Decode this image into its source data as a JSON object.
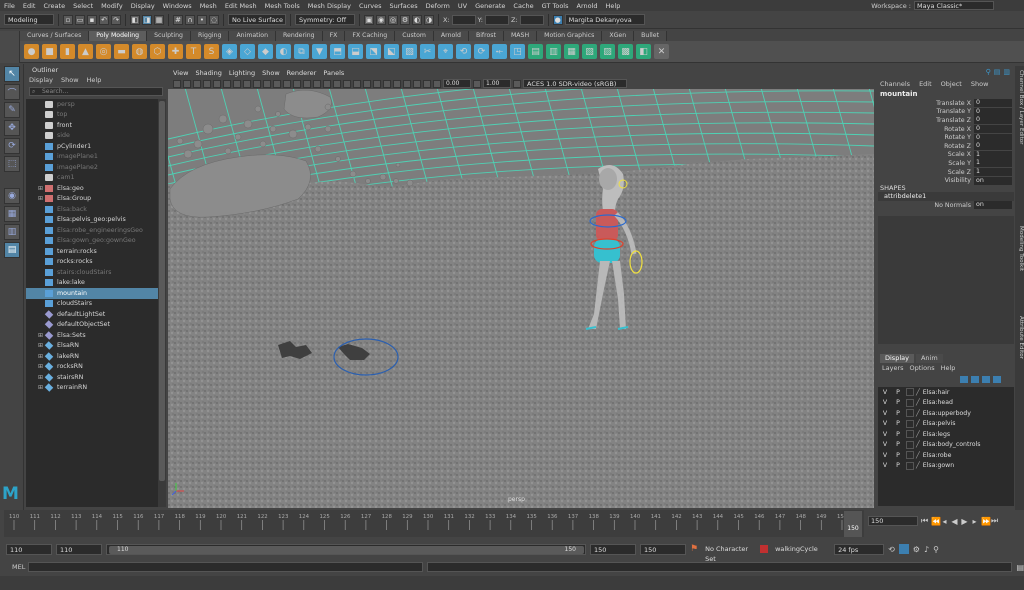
{
  "menubar": {
    "items": [
      "File",
      "Edit",
      "Create",
      "Select",
      "Modify",
      "Display",
      "Windows",
      "Mesh",
      "Edit Mesh",
      "Mesh Tools",
      "Mesh Display",
      "Curves",
      "Surfaces",
      "Deform",
      "UV",
      "Generate",
      "Cache",
      "GT Tools",
      "Arnold",
      "Help"
    ],
    "workspace_label": "Workspace :",
    "workspace_value": "Maya Classic*"
  },
  "statusline": {
    "mode": "Modeling",
    "live_surface": "No Live Surface",
    "symmetry": "Symmetry: Off",
    "x_label": "X:",
    "y_label": "Y:",
    "z_label": "Z:",
    "user": "Margita Dekanyova"
  },
  "shelf": {
    "tabs": [
      "Curves / Surfaces",
      "Poly Modeling",
      "Sculpting",
      "Rigging",
      "Animation",
      "Rendering",
      "FX",
      "FX Caching",
      "Custom",
      "Arnold",
      "Bifrost",
      "MASH",
      "Motion Graphics",
      "XGen",
      "Bullet"
    ],
    "active_tab": "Poly Modeling"
  },
  "outliner": {
    "title": "Outliner",
    "menu": [
      "Display",
      "Show",
      "Help"
    ],
    "search_placeholder": "Search...",
    "items": [
      {
        "label": "persp",
        "dim": true,
        "exp": false,
        "icon": "camera"
      },
      {
        "label": "top",
        "dim": true,
        "exp": false,
        "icon": "camera"
      },
      {
        "label": "front",
        "dim": false,
        "exp": false,
        "icon": "camera"
      },
      {
        "label": "side",
        "dim": true,
        "exp": false,
        "icon": "camera"
      },
      {
        "label": "pCylinder1",
        "dim": false,
        "exp": false,
        "icon": "mesh"
      },
      {
        "label": "imagePlane1",
        "dim": true,
        "exp": false,
        "icon": "mesh"
      },
      {
        "label": "imagePlane2",
        "dim": true,
        "exp": false,
        "icon": "mesh"
      },
      {
        "label": "cam1",
        "dim": true,
        "exp": false,
        "icon": "camera"
      },
      {
        "label": "Elsa:geo",
        "dim": false,
        "exp": true,
        "icon": "group"
      },
      {
        "label": "Elsa:Group",
        "dim": false,
        "exp": true,
        "icon": "group"
      },
      {
        "label": "Elsa:back",
        "dim": true,
        "exp": false,
        "icon": "mesh"
      },
      {
        "label": "Elsa:pelvis_geo:pelvis",
        "dim": false,
        "exp": false,
        "icon": "mesh"
      },
      {
        "label": "Elsa:robe_engineeringsGeo",
        "dim": true,
        "exp": false,
        "icon": "mesh"
      },
      {
        "label": "Elsa:gown_geo:gownGeo",
        "dim": true,
        "exp": false,
        "icon": "mesh"
      },
      {
        "label": "terrain:rocks",
        "dim": false,
        "exp": false,
        "icon": "mesh"
      },
      {
        "label": "rocks:rocks",
        "dim": false,
        "exp": false,
        "icon": "mesh"
      },
      {
        "label": "stairs:cloudStairs",
        "dim": true,
        "exp": false,
        "icon": "mesh"
      },
      {
        "label": "lake:lake",
        "dim": false,
        "exp": false,
        "icon": "mesh"
      },
      {
        "label": "mountain",
        "dim": false,
        "exp": false,
        "icon": "mesh",
        "selected": true
      },
      {
        "label": "cloudStairs",
        "dim": false,
        "exp": false,
        "icon": "mesh"
      },
      {
        "label": "defaultLightSet",
        "dim": false,
        "exp": false,
        "icon": "set"
      },
      {
        "label": "defaultObjectSet",
        "dim": false,
        "exp": false,
        "icon": "set"
      },
      {
        "label": "Elsa:Sets",
        "dim": false,
        "exp": true,
        "icon": "set"
      },
      {
        "label": "ElsaRN",
        "dim": false,
        "exp": true,
        "icon": "ref"
      },
      {
        "label": "lakeRN",
        "dim": false,
        "exp": true,
        "icon": "ref"
      },
      {
        "label": "rocksRN",
        "dim": false,
        "exp": true,
        "icon": "ref"
      },
      {
        "label": "stairsRN",
        "dim": false,
        "exp": true,
        "icon": "ref"
      },
      {
        "label": "terrainRN",
        "dim": false,
        "exp": true,
        "icon": "ref"
      }
    ]
  },
  "viewport": {
    "menu": [
      "View",
      "Shading",
      "Lighting",
      "Show",
      "Renderer",
      "Panels"
    ],
    "near_value": "0.00",
    "far_value": "1.00",
    "colorspace": "ACES 1.0 SDR-video (sRGB)",
    "camera_label": "persp"
  },
  "channelbox": {
    "menu": [
      "Channels",
      "Edit",
      "Object",
      "Show"
    ],
    "object_name": "mountain",
    "attributes": [
      {
        "name": "Translate X",
        "value": "0"
      },
      {
        "name": "Translate Y",
        "value": "0"
      },
      {
        "name": "Translate Z",
        "value": "0"
      },
      {
        "name": "Rotate X",
        "value": "0"
      },
      {
        "name": "Rotate Y",
        "value": "0"
      },
      {
        "name": "Rotate Z",
        "value": "0"
      },
      {
        "name": "Scale X",
        "value": "1"
      },
      {
        "name": "Scale Y",
        "value": "1"
      },
      {
        "name": "Scale Z",
        "value": "1"
      },
      {
        "name": "Visibility",
        "value": "on"
      }
    ],
    "shapes_label": "SHAPES",
    "shape_name": "attribdelete1",
    "no_normals_label": "No Normals",
    "no_normals_value": "on"
  },
  "layer_editor": {
    "tabs": [
      "Display",
      "Anim"
    ],
    "menu": [
      "Layers",
      "Options",
      "Help"
    ],
    "layers": [
      {
        "name": "Elsa:hair",
        "v": "V",
        "p": "P"
      },
      {
        "name": "Elsa:head",
        "v": "V",
        "p": "P"
      },
      {
        "name": "Elsa:upperbody",
        "v": "V",
        "p": "P"
      },
      {
        "name": "Elsa:pelvis",
        "v": "V",
        "p": "P"
      },
      {
        "name": "Elsa:legs",
        "v": "V",
        "p": "P"
      },
      {
        "name": "Elsa:body_controls",
        "v": "V",
        "p": "P"
      },
      {
        "name": "Elsa:robe",
        "v": "V",
        "p": "P"
      },
      {
        "name": "Elsa:gown",
        "v": "V",
        "p": "P"
      }
    ]
  },
  "side_tabs": [
    "Channel Box / Layer Editor",
    "Modeling Toolkit",
    "Attribute Editor"
  ],
  "timeslider": {
    "ticks": [
      "110",
      "111",
      "112",
      "113",
      "114",
      "115",
      "116",
      "117",
      "118",
      "119",
      "120",
      "121",
      "122",
      "123",
      "124",
      "125",
      "126",
      "127",
      "128",
      "129",
      "130",
      "131",
      "132",
      "133",
      "134",
      "135",
      "136",
      "137",
      "138",
      "139",
      "140",
      "141",
      "142",
      "143",
      "144",
      "145",
      "146",
      "147",
      "148",
      "149",
      "150"
    ],
    "current_frame": "150",
    "current_frame_field": "150"
  },
  "range": {
    "start": "110",
    "start_inner": "110",
    "thumb_left": "110",
    "thumb_right": "150",
    "end_inner": "150",
    "end": "150",
    "character_set": "No Character Set",
    "anim_layer": "walkingCycle",
    "fps": "24 fps"
  },
  "cmdline": {
    "label": "MEL"
  },
  "colors": {
    "accent": "#5285a6",
    "grid": "#4fd1b4",
    "panel": "#444444",
    "field": "#2b2b2b"
  }
}
